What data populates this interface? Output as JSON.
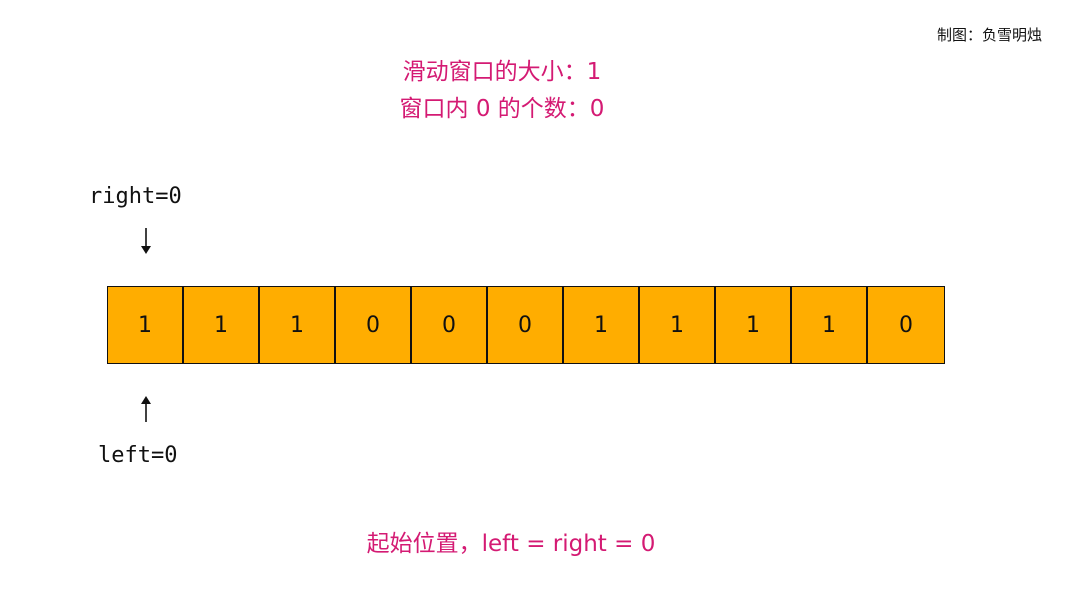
{
  "credit": "制图：负雪明烛",
  "window_info": {
    "size_line": "滑动窗口的大小：1",
    "zero_count_line": "窗口内 0 的个数：0"
  },
  "pointers": {
    "right": {
      "label": "right=0",
      "index": 0
    },
    "left": {
      "label": "left=0",
      "index": 0
    }
  },
  "array": [
    "1",
    "1",
    "1",
    "0",
    "0",
    "0",
    "1",
    "1",
    "1",
    "1",
    "0"
  ],
  "caption": "起始位置，left = right = 0",
  "colors": {
    "cell_fill": "#ffad00",
    "highlight_text": "#d41a73"
  }
}
